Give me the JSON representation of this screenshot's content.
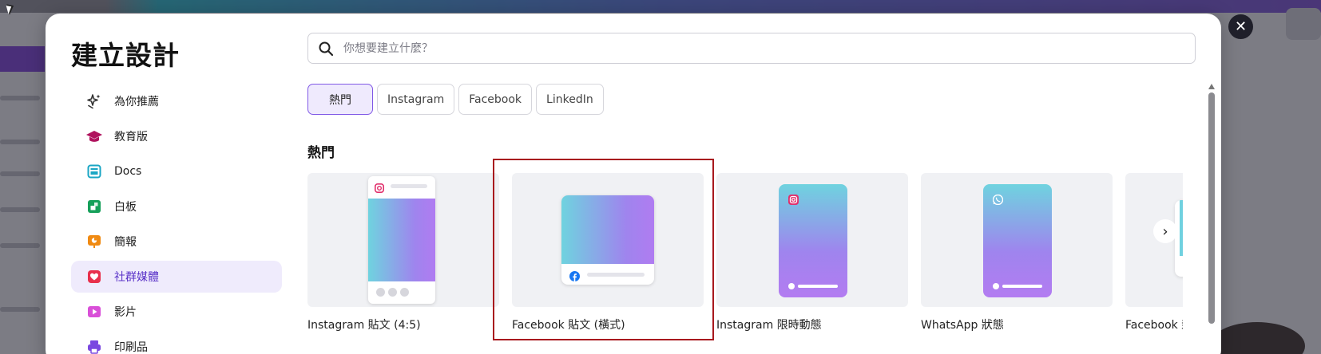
{
  "modal": {
    "title": "建立設計",
    "close_symbol": "✕"
  },
  "sidebar": {
    "items": [
      {
        "label": "為你推薦",
        "icon": "sparkle-icon",
        "color": "#333333"
      },
      {
        "label": "教育版",
        "icon": "graduation-cap-icon",
        "color": "#b0145e"
      },
      {
        "label": "Docs",
        "icon": "docs-icon",
        "color": "#1aa6c4"
      },
      {
        "label": "白板",
        "icon": "whiteboard-icon",
        "color": "#16a05a"
      },
      {
        "label": "簡報",
        "icon": "presentation-icon",
        "color": "#f08a12"
      },
      {
        "label": "社群媒體",
        "icon": "heart-icon",
        "color": "#e8304c",
        "active": true
      },
      {
        "label": "影片",
        "icon": "video-icon",
        "color": "#d94fd8"
      },
      {
        "label": "印刷品",
        "icon": "print-icon",
        "color": "#7a48e0"
      }
    ]
  },
  "search": {
    "placeholder": "你想要建立什麼？"
  },
  "chips": [
    {
      "label": "熱門",
      "active": true
    },
    {
      "label": "Instagram"
    },
    {
      "label": "Facebook"
    },
    {
      "label": "LinkedIn"
    }
  ],
  "section": {
    "title": "熱門"
  },
  "cards": [
    {
      "label": "Instagram 貼文 (4:5)",
      "icon": "instagram-icon"
    },
    {
      "label": "Facebook 貼文 (橫式)",
      "icon": "facebook-icon"
    },
    {
      "label": "Instagram 限時動態",
      "icon": "instagram-icon"
    },
    {
      "label": "WhatsApp 狀態",
      "icon": "whatsapp-icon"
    },
    {
      "label": "Facebook 封面",
      "icon": "facebook-icon"
    }
  ],
  "next_symbol": "›",
  "colors": {
    "accent": "#8058e6",
    "highlight_border": "#a8191e"
  }
}
